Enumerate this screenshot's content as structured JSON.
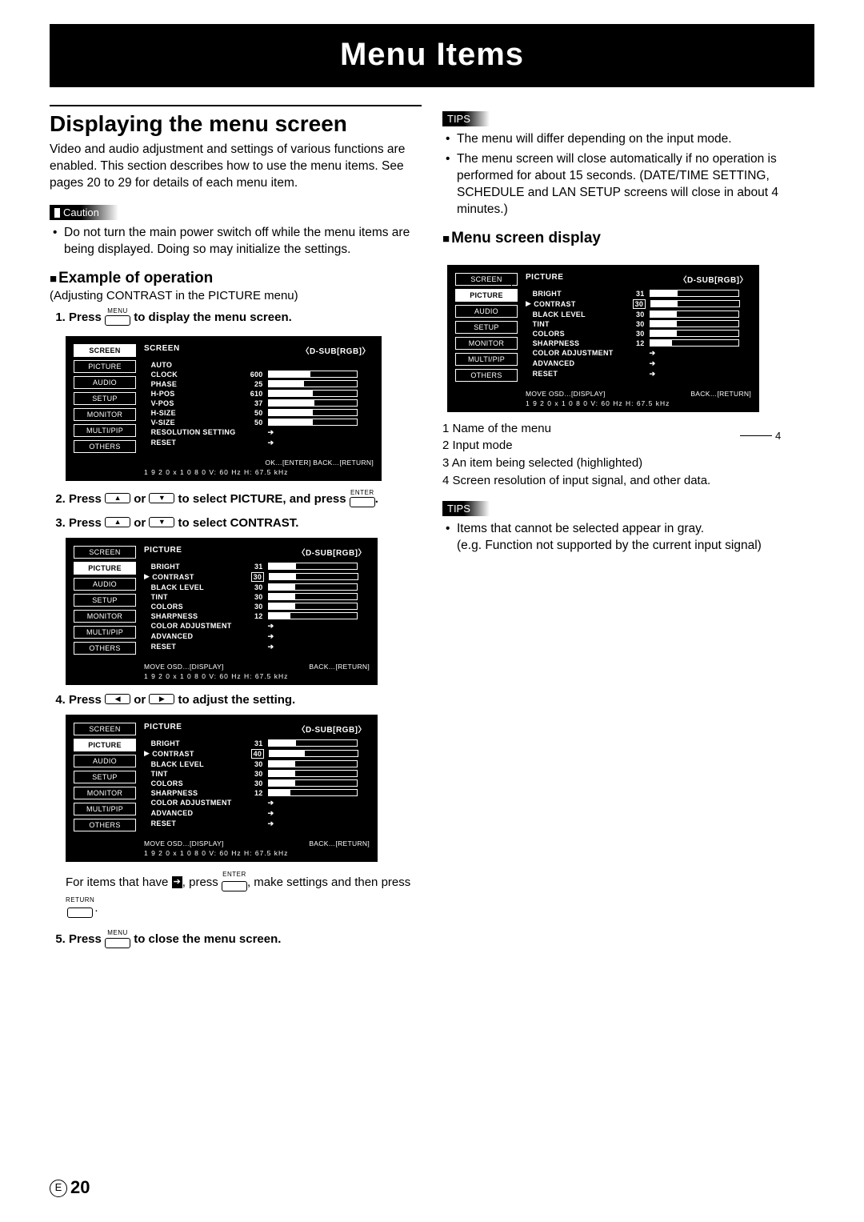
{
  "page": {
    "title": "Menu Items",
    "number_label": "20",
    "number_prefix": "E"
  },
  "left": {
    "section_title": "Displaying the menu screen",
    "intro": "Video and audio adjustment and settings of various functions are enabled. This section describes how to use the menu items. See pages 20 to 29 for details of each menu item.",
    "caution_label": "Caution",
    "caution_item": "Do not turn the main power switch off while the menu items are being displayed. Doing so may initialize the settings.",
    "example_head": "Example of operation",
    "example_sub": "(Adjusting CONTRAST in the PICTURE menu)",
    "steps": {
      "s1_a": "Press ",
      "s1_key": "MENU",
      "s1_b": " to display the menu screen.",
      "s2_a": "Press ",
      "s2_b": " or ",
      "s2_c": " to select PICTURE, and press ",
      "s2_key": "ENTER",
      "s2_d": ".",
      "s3_a": "Press ",
      "s3_b": " or ",
      "s3_c": " to select CONTRAST.",
      "s4_a": "Press ",
      "s4_b": " or ",
      "s4_c": " to adjust the setting.",
      "after_a": "For items that have ",
      "after_b": ", press ",
      "after_key1": "ENTER",
      "after_c": ", make settings and then press ",
      "after_key2": "RETURN",
      "after_d": ".",
      "s5_a": "Press ",
      "s5_key": "MENU",
      "s5_b": " to close the menu screen."
    }
  },
  "right": {
    "tips_label": "TIPS",
    "tips1": [
      "The menu will differ depending on the input mode.",
      "The menu screen will close automatically if no operation is performed for about 15 seconds. (DATE/TIME SETTING, SCHEDULE and LAN SETUP screens will close in about 4 minutes.)"
    ],
    "menu_display_head": "Menu screen display",
    "legend": [
      "Name of the menu",
      "Input mode",
      "An item being selected (highlighted)",
      "Screen resolution of input signal, and other data."
    ],
    "tips2": [
      "Items that cannot be selected appear in gray.\n(e.g. Function not supported by the current input signal)"
    ]
  },
  "osd_tabs": [
    "SCREEN",
    "PICTURE",
    "AUDIO",
    "SETUP",
    "MONITOR",
    "MULTI/PIP",
    "OTHERS"
  ],
  "osd_input": "〈D-SUB[RGB]〉",
  "osd_screen": {
    "title": "SCREEN",
    "items": [
      {
        "name": "AUTO",
        "val": "",
        "type": "none"
      },
      {
        "name": "CLOCK",
        "val": "600",
        "type": "bar",
        "pct": 48
      },
      {
        "name": "PHASE",
        "val": "25",
        "type": "bar",
        "pct": 40
      },
      {
        "name": "H-POS",
        "val": "610",
        "type": "bar",
        "pct": 50
      },
      {
        "name": "V-POS",
        "val": "37",
        "type": "bar",
        "pct": 52
      },
      {
        "name": "H-SIZE",
        "val": "50",
        "type": "bar",
        "pct": 50
      },
      {
        "name": "V-SIZE",
        "val": "50",
        "type": "bar",
        "pct": 50
      },
      {
        "name": "RESOLUTION SETTING",
        "val": "",
        "type": "enter"
      },
      {
        "name": "RESET",
        "val": "",
        "type": "enter"
      }
    ],
    "foot_right": "OK…[ENTER]  BACK…[RETURN]",
    "foot2": "1 9 2 0 x 1 0 8 0      V: 60 Hz    H: 67.5 kHz"
  },
  "osd_picture_30": {
    "title": "PICTURE",
    "selected": "CONTRAST",
    "items": [
      {
        "name": "BRIGHT",
        "val": "31",
        "type": "bar",
        "pct": 31
      },
      {
        "name": "CONTRAST",
        "val": "30",
        "type": "bar",
        "pct": 30,
        "sel": true
      },
      {
        "name": "BLACK LEVEL",
        "val": "30",
        "type": "bar",
        "pct": 30
      },
      {
        "name": "TINT",
        "val": "30",
        "type": "bar",
        "pct": 30
      },
      {
        "name": "COLORS",
        "val": "30",
        "type": "bar",
        "pct": 30
      },
      {
        "name": "SHARPNESS",
        "val": "12",
        "type": "bar",
        "pct": 25
      },
      {
        "name": "COLOR ADJUSTMENT",
        "val": "",
        "type": "enter"
      },
      {
        "name": "ADVANCED",
        "val": "",
        "type": "enter"
      },
      {
        "name": "RESET",
        "val": "",
        "type": "enter"
      }
    ],
    "foot_left": "MOVE OSD…[DISPLAY]",
    "foot_right": "BACK…[RETURN]",
    "foot2": "1 9 2 0 x 1 0 8 0      V: 60 Hz    H: 67.5 kHz"
  },
  "osd_picture_40": {
    "title": "PICTURE",
    "items": [
      {
        "name": "BRIGHT",
        "val": "31",
        "type": "bar",
        "pct": 31
      },
      {
        "name": "CONTRAST",
        "val": "40",
        "type": "bar",
        "pct": 40,
        "sel": true
      },
      {
        "name": "BLACK LEVEL",
        "val": "30",
        "type": "bar",
        "pct": 30
      },
      {
        "name": "TINT",
        "val": "30",
        "type": "bar",
        "pct": 30
      },
      {
        "name": "COLORS",
        "val": "30",
        "type": "bar",
        "pct": 30
      },
      {
        "name": "SHARPNESS",
        "val": "12",
        "type": "bar",
        "pct": 25
      },
      {
        "name": "COLOR ADJUSTMENT",
        "val": "",
        "type": "enter"
      },
      {
        "name": "ADVANCED",
        "val": "",
        "type": "enter"
      },
      {
        "name": "RESET",
        "val": "",
        "type": "enter"
      }
    ],
    "foot_left": "MOVE OSD…[DISPLAY]",
    "foot_right": "BACK…[RETURN]",
    "foot2": "1 9 2 0 x 1 0 8 0      V: 60 Hz    H: 67.5 kHz"
  }
}
